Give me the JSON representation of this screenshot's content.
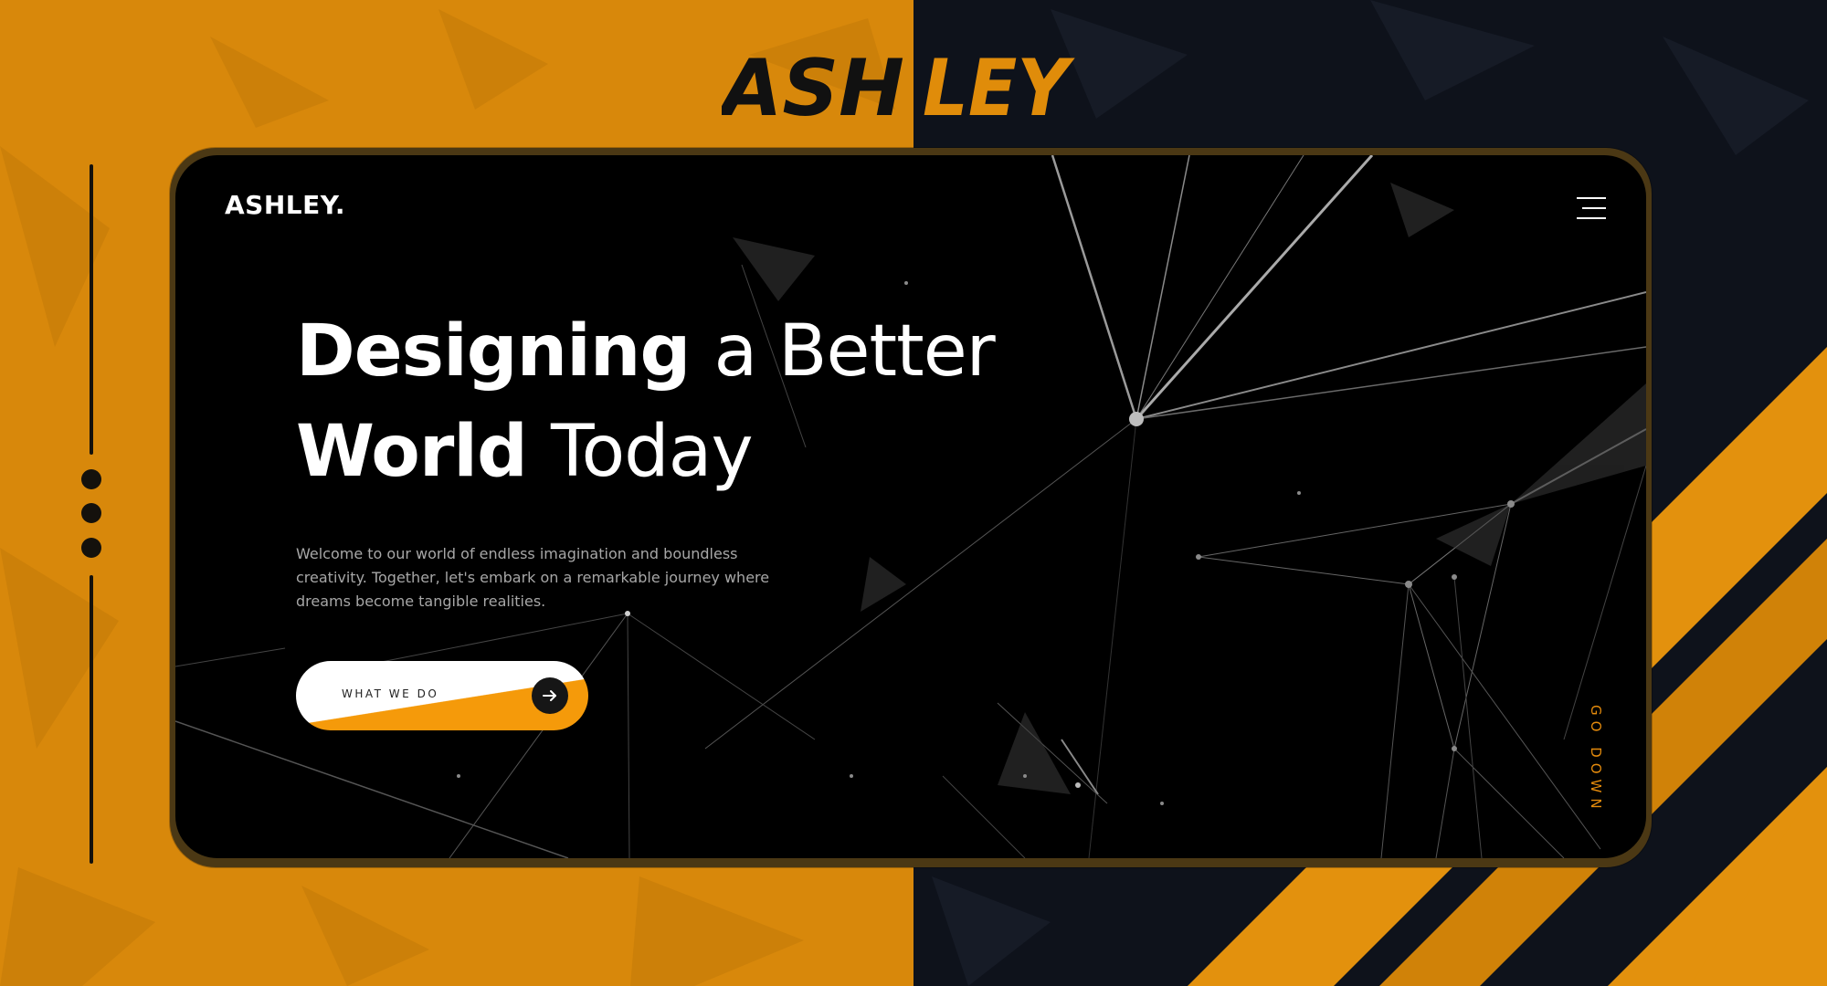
{
  "banner": {
    "title_left": "ASH",
    "title_right": "LEY"
  },
  "site": {
    "logo": "ASHLEY.",
    "menu_icon": "hamburger-menu-icon"
  },
  "hero": {
    "line1_bold": "Designing",
    "line1_light": "a Better",
    "line2_bold": "World",
    "line2_light": "Today",
    "description": "Welcome to our world of endless imagination and boundless creativity. Together, let's embark on a remarkable journey where dreams become tangible realities.",
    "cta_label": "WHAT WE DO",
    "cta_icon": "arrow-right-icon",
    "scroll_label": "GO DOWN"
  },
  "colors": {
    "accent_orange": "#d8880b",
    "button_orange": "#f59a0a",
    "dark_navy": "#0e121b",
    "screen_black": "#000000",
    "text_light": "#ffffff",
    "text_muted": "#a7a7a7"
  }
}
